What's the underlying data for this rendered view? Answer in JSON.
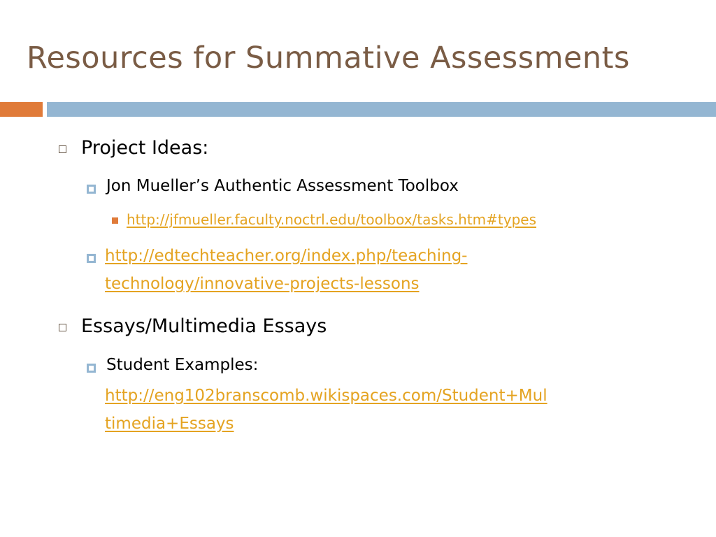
{
  "slide": {
    "title": "Resources for Summative Assessments"
  },
  "theme": {
    "title_color": "#7a5c45",
    "accent_orange": "#e07b39",
    "accent_blue": "#94b6d2",
    "link_color": "#e4a321"
  },
  "content": {
    "project_ideas": {
      "label": "Project Ideas:",
      "mueller": {
        "label": "Jon Mueller’s Authentic Assessment Toolbox",
        "link": "http://jfmueller.faculty.noctrl.edu/toolbox/tasks.htm#types"
      },
      "edtech_link_line1": "http://edtechteacher.org/index.php/teaching-",
      "edtech_link_line2": "technology/innovative-projects-lessons"
    },
    "essays": {
      "label": "Essays/Multimedia Essays",
      "student_examples": {
        "label": "Student Examples:",
        "link_line1": "http://eng102branscomb.wikispaces.com/Student+Mul",
        "link_line2": "timedia+Essays"
      }
    }
  }
}
